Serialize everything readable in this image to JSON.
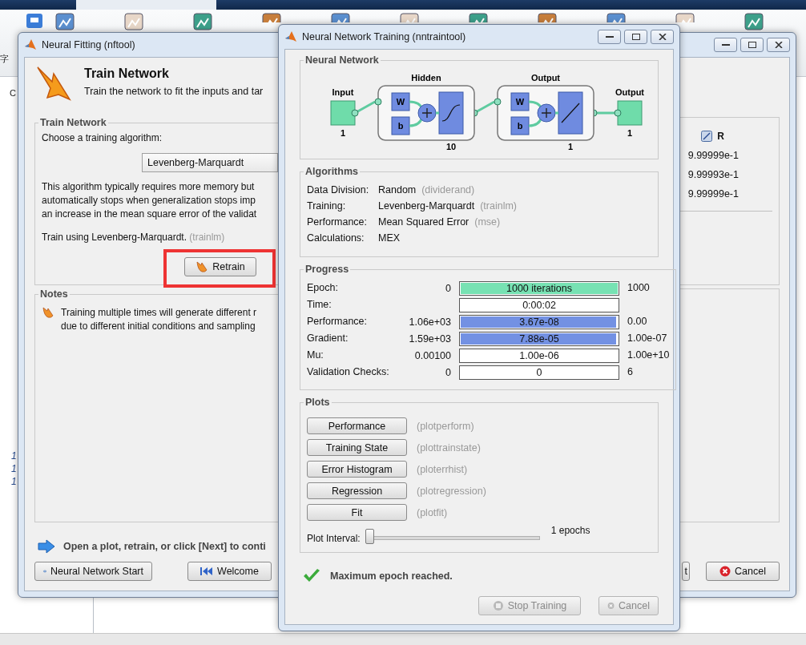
{
  "background": {
    "ribbon_label": "字",
    "path_label": "C",
    "workspace_values": [
      "1",
      "1",
      "1"
    ]
  },
  "nftool": {
    "title": "Neural Fitting (nftool)",
    "header": {
      "title": "Train Network",
      "subtitle": "Train the network to fit the inputs and tar"
    },
    "train_panel": {
      "legend": "Train Network",
      "prompt": "Choose a training algorithm:",
      "algorithm": "Levenberg-Marquardt",
      "description": [
        "This algorithm typically requires more memory but",
        "automatically stops when generalization stops imp",
        "an increase in the mean square error of the validat"
      ],
      "train_using": "Train using Levenberg-Marquardt.",
      "train_fn": "(trainlm)",
      "retrain": "Retrain",
      "highlighted": true
    },
    "notes": {
      "legend": "Notes",
      "lines": [
        "Training multiple times will generate different r",
        "due to different initial conditions and sampling"
      ]
    },
    "results": {
      "column": "R",
      "values": [
        "9.99999e-1",
        "9.99993e-1",
        "9.99999e-1"
      ]
    },
    "footer": "Open a plot, retrain, or click [Next] to conti",
    "buttons": [
      {
        "kind": "start",
        "label": "Neural Network Start"
      },
      {
        "kind": "welcome",
        "label": "Welcome"
      }
    ],
    "next_fragment": "t",
    "cancel": "Cancel"
  },
  "train": {
    "title": "Neural Network Training (nntraintool)",
    "network": {
      "legend": "Neural Network",
      "input": {
        "label": "Input",
        "size": "1"
      },
      "layers": [
        {
          "title": "Hidden",
          "size": "10",
          "weight": "W",
          "bias": "b",
          "kind": "sigmoid"
        },
        {
          "title": "Output",
          "size": "1",
          "weight": "W",
          "bias": "b",
          "kind": "linear"
        }
      ],
      "output": {
        "label": "Output",
        "size": "1"
      }
    },
    "algorithms": {
      "legend": "Algorithms",
      "rows": [
        {
          "label": "Data Division:",
          "value": "Random",
          "note": "(dividerand)"
        },
        {
          "label": "Training:",
          "value": "Levenberg-Marquardt",
          "note": "(trainlm)"
        },
        {
          "label": "Performance:",
          "value": "Mean Squared Error",
          "note": "(mse)"
        },
        {
          "label": "Calculations:",
          "value": "MEX"
        }
      ]
    },
    "progress": {
      "legend": "Progress",
      "rows": [
        {
          "label": "Epoch:",
          "start": "0",
          "value": "1000 iterations",
          "end": "1000",
          "level": 1,
          "color": "#77e2b3"
        },
        {
          "label": "Time:",
          "value": "0:00:02"
        },
        {
          "label": "Performance:",
          "start": "1.06e+03",
          "value": "3.67e-08",
          "end": "0.00",
          "level": 0.99,
          "color": "#7391e3"
        },
        {
          "label": "Gradient:",
          "start": "1.59e+03",
          "value": "7.88e-05",
          "end": "1.00e-07",
          "level": 0.99,
          "color": "#7391e3"
        },
        {
          "label": "Mu:",
          "start": "0.00100",
          "value": "1.00e-06",
          "end": "1.00e+10"
        },
        {
          "label": "Validation Checks:",
          "start": "0",
          "value": "0",
          "end": "6"
        }
      ]
    },
    "plots": {
      "legend": "Plots",
      "buttons": [
        {
          "label": "Performance",
          "fn": "(plotperform)"
        },
        {
          "label": "Training State",
          "fn": "(plottrainstate)"
        },
        {
          "label": "Error Histogram",
          "fn": "(ploterrhist)"
        },
        {
          "label": "Regression",
          "fn": "(plotregression)"
        },
        {
          "label": "Fit",
          "fn": "(plotfit)"
        }
      ],
      "interval": {
        "label": "Plot Interval:",
        "level": 0,
        "reading": "1 epochs"
      }
    },
    "status": "Maximum epoch reached.",
    "buttons": [
      {
        "kind": "stop",
        "label": "Stop Training",
        "disabled": true
      },
      {
        "kind": "cancel",
        "label": "Cancel",
        "disabled": true
      }
    ]
  }
}
